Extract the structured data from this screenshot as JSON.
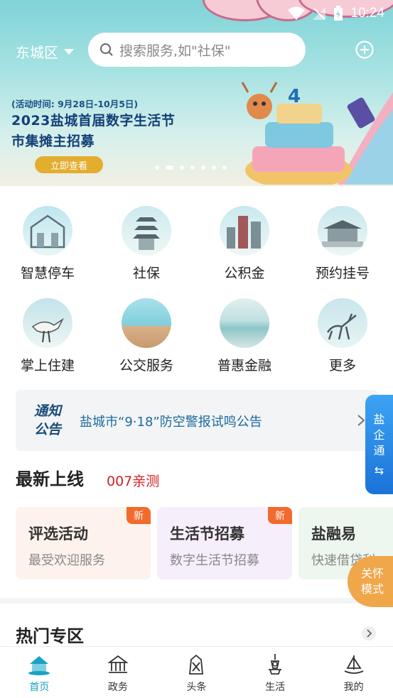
{
  "status_bar": {
    "time": "10:24",
    "icons": [
      "wifi-icon",
      "no-signal-icon",
      "battery-icon"
    ]
  },
  "header": {
    "city": "东城区",
    "search_placeholder": "搜索服务,如\"社保\""
  },
  "banner": {
    "date_text": "(活动时间: 9月28日-10月5日)",
    "title_line1": "2023盐城首届数字生活节",
    "title_line2": "市集摊主招募",
    "cta_label": "立即查看",
    "carousel_count": 7,
    "carousel_active_index": 1
  },
  "services": [
    {
      "label": "智慧停车",
      "icon": "parking-building-icon"
    },
    {
      "label": "社保",
      "icon": "pagoda-icon"
    },
    {
      "label": "公积金",
      "icon": "city-towers-icon"
    },
    {
      "label": "预约挂号",
      "icon": "temple-icon"
    },
    {
      "label": "掌上住建",
      "icon": "crane-bird-icon"
    },
    {
      "label": "公交服务",
      "icon": "seaside-icon"
    },
    {
      "label": "普惠金融",
      "icon": "wetland-icon"
    },
    {
      "label": "更多",
      "icon": "deer-icon"
    }
  ],
  "notice": {
    "logo_line1": "通知",
    "logo_line2": "公告",
    "text": "盐城市“9·18”防空警报试鸣公告"
  },
  "latest": {
    "title": "最新上线",
    "subtitle": "007亲测",
    "cards": [
      {
        "title": "评选活动",
        "subtitle": "最受欢迎服务",
        "badge": "新",
        "bg": "#fdf3ec"
      },
      {
        "title": "生活节招募",
        "subtitle": "数字生活节招募",
        "badge": "新",
        "bg": "#f6eefa"
      },
      {
        "title": "盐融易",
        "subtitle": "快速借贷利",
        "badge": "",
        "bg": "#eef7ef"
      }
    ]
  },
  "float_enterprise": {
    "chars": [
      "盐",
      "企",
      "通",
      "⇆"
    ]
  },
  "float_care": {
    "line1": "关怀",
    "line2": "模式"
  },
  "hot": {
    "title": "热门专区"
  },
  "tabs": [
    {
      "label": "首页",
      "active": true
    },
    {
      "label": "政务",
      "active": false
    },
    {
      "label": "头条",
      "active": false
    },
    {
      "label": "生活",
      "active": false
    },
    {
      "label": "我的",
      "active": false
    }
  ],
  "colors": {
    "accent": "#18a3c4",
    "notice_text": "#1b6a9c",
    "badge": "#f36a2d",
    "red": "#d42020"
  }
}
